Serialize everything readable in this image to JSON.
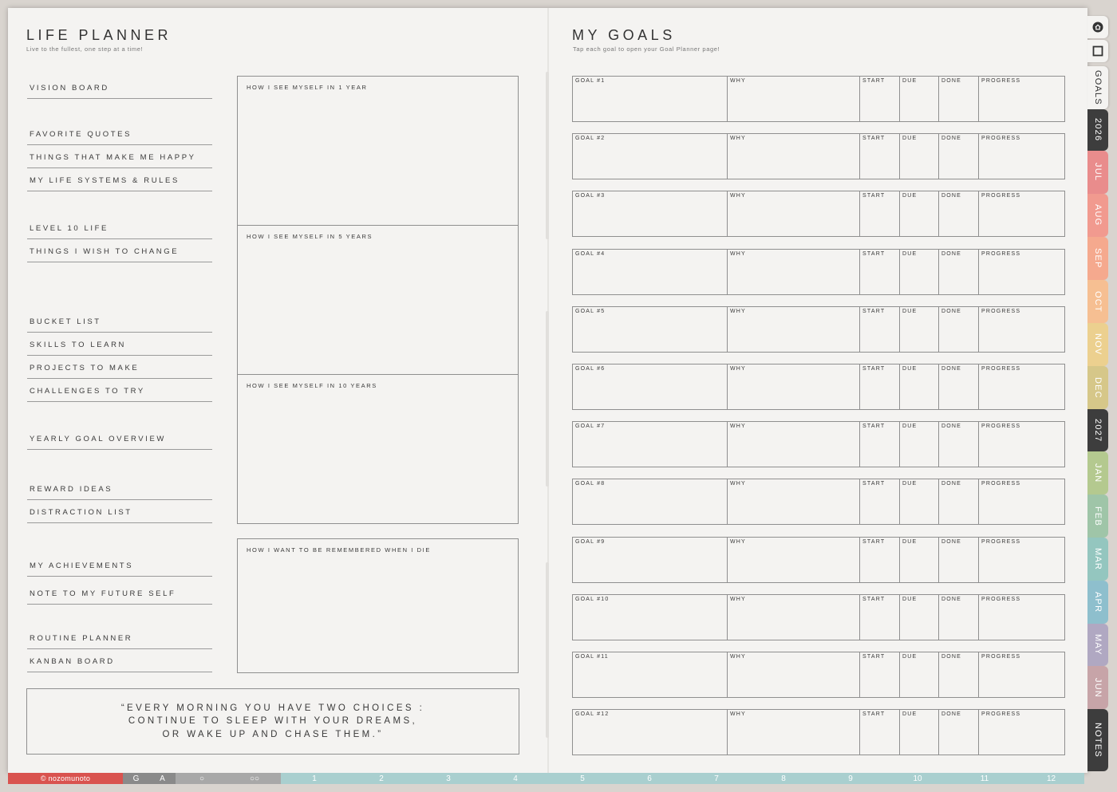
{
  "left_page": {
    "title": "LIFE PLANNER",
    "subtitle": "Live to the fullest, one step at a time!",
    "nav": [
      {
        "label": "VISION BOARD"
      },
      {
        "label": "FAVORITE QUOTES"
      },
      {
        "label": "THINGS THAT MAKE ME HAPPY"
      },
      {
        "label": "MY LIFE SYSTEMS & RULES"
      },
      {
        "label": "LEVEL 10 LIFE"
      },
      {
        "label": "THINGS I WISH TO CHANGE"
      },
      {
        "label": "BUCKET LIST"
      },
      {
        "label": "SKILLS TO LEARN"
      },
      {
        "label": "PROJECTS TO MAKE"
      },
      {
        "label": "CHALLENGES TO TRY"
      },
      {
        "label": "YEARLY GOAL OVERVIEW"
      },
      {
        "label": "REWARD IDEAS"
      },
      {
        "label": "DISTRACTION LIST"
      },
      {
        "label": "MY ACHIEVEMENTS"
      },
      {
        "label": "NOTE TO MY FUTURE SELF"
      },
      {
        "label": "ROUTINE PLANNER"
      },
      {
        "label": "KANBAN BOARD"
      }
    ],
    "vision_boxes": [
      {
        "label": "HOW I SEE MYSELF IN 1 YEAR"
      },
      {
        "label": "HOW I SEE MYSELF IN 5 YEARS"
      },
      {
        "label": "HOW I SEE MYSELF IN 10 YEARS"
      },
      {
        "label": "HOW I WANT TO BE REMEMBERED WHEN I DIE"
      }
    ],
    "quote": {
      "line1": "“EVERY MORNING YOU HAVE TWO CHOICES :",
      "line2": "CONTINUE TO SLEEP WITH YOUR DREAMS,",
      "line3": "OR WAKE UP AND CHASE THEM.”"
    }
  },
  "right_page": {
    "title": "MY GOALS",
    "subtitle": "Tap each goal to open your Goal Planner page!",
    "columns": {
      "why": "WHY",
      "start": "START",
      "due": "DUE",
      "done": "DONE",
      "progress": "PROGRESS"
    },
    "goals": [
      {
        "label": "GOAL #1"
      },
      {
        "label": "GOAL #2"
      },
      {
        "label": "GOAL #3"
      },
      {
        "label": "GOAL #4"
      },
      {
        "label": "GOAL #5"
      },
      {
        "label": "GOAL #6"
      },
      {
        "label": "GOAL #7"
      },
      {
        "label": "GOAL #8"
      },
      {
        "label": "GOAL #9"
      },
      {
        "label": "GOAL #10"
      },
      {
        "label": "GOAL #11"
      },
      {
        "label": "GOAL #12"
      }
    ]
  },
  "side_tabs": {
    "icons": [
      {
        "icon": "home-icon"
      },
      {
        "icon": "square-icon"
      }
    ],
    "tabs": [
      {
        "label": "GOALS",
        "color": "#f4f3f1",
        "text_color": "#333333"
      },
      {
        "label": "2026",
        "color": "#3d3d3d"
      },
      {
        "label": "JUL",
        "color": "#e98c8c"
      },
      {
        "label": "AUG",
        "color": "#f19a8f"
      },
      {
        "label": "SEP",
        "color": "#f5a98e"
      },
      {
        "label": "OCT",
        "color": "#f6bf92"
      },
      {
        "label": "NOV",
        "color": "#ecd08f"
      },
      {
        "label": "DEC",
        "color": "#d6c789"
      },
      {
        "label": "2027",
        "color": "#3d3d3d"
      },
      {
        "label": "JAN",
        "color": "#b4c98f"
      },
      {
        "label": "FEB",
        "color": "#9fc5a8"
      },
      {
        "label": "MAR",
        "color": "#94c6bf"
      },
      {
        "label": "APR",
        "color": "#8ebfcd"
      },
      {
        "label": "MAY",
        "color": "#b0a8c2"
      },
      {
        "label": "JUN",
        "color": "#c7a4a8"
      },
      {
        "label": "NOTES",
        "color": "#3d3d3d"
      }
    ]
  },
  "bottom_bar": {
    "brand": "© nozomunoto",
    "cells": [
      {
        "label": "G",
        "color": "#8a8a8a"
      },
      {
        "label": "A",
        "color": "#8a8a8a"
      },
      {
        "label": "○",
        "color": "#a8a8a8"
      },
      {
        "label": "○○",
        "color": "#a8a8a8"
      },
      {
        "label": "1",
        "color": "#a9cfcf"
      },
      {
        "label": "2",
        "color": "#a9cfcf"
      },
      {
        "label": "3",
        "color": "#a9cfcf"
      },
      {
        "label": "4",
        "color": "#a9cfcf"
      },
      {
        "label": "5",
        "color": "#a9cfcf"
      },
      {
        "label": "6",
        "color": "#a9cfcf"
      },
      {
        "label": "7",
        "color": "#a9cfcf"
      },
      {
        "label": "8",
        "color": "#a9cfcf"
      },
      {
        "label": "9",
        "color": "#a9cfcf"
      },
      {
        "label": "10",
        "color": "#a9cfcf"
      },
      {
        "label": "11",
        "color": "#a9cfcf"
      },
      {
        "label": "12",
        "color": "#a9cfcf"
      }
    ]
  }
}
